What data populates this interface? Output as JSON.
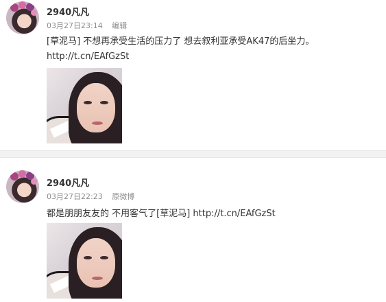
{
  "posts": [
    {
      "username": "2940凡凡",
      "timestamp": "03月27日23:14",
      "source": "编辑",
      "text": "[草泥马] 不想再承受生活的压力了 想去叙利亚承受AK47的后坐力。",
      "link": "http://t.cn/EAfGzSt",
      "avatar_icon": "profile-avatar",
      "photo_icon": "selfie-photo"
    },
    {
      "username": "2940凡凡",
      "timestamp": "03月27日22:23",
      "source": "原微博",
      "text": "都是朋朋友友的 不用客气了[草泥马] http://t.cn/EAfGzSt",
      "avatar_icon": "profile-avatar",
      "photo_icon": "selfie-photo"
    }
  ],
  "colors": {
    "text": "#333333",
    "meta": "#8c8c8c",
    "separator": "#f2f2f2"
  }
}
